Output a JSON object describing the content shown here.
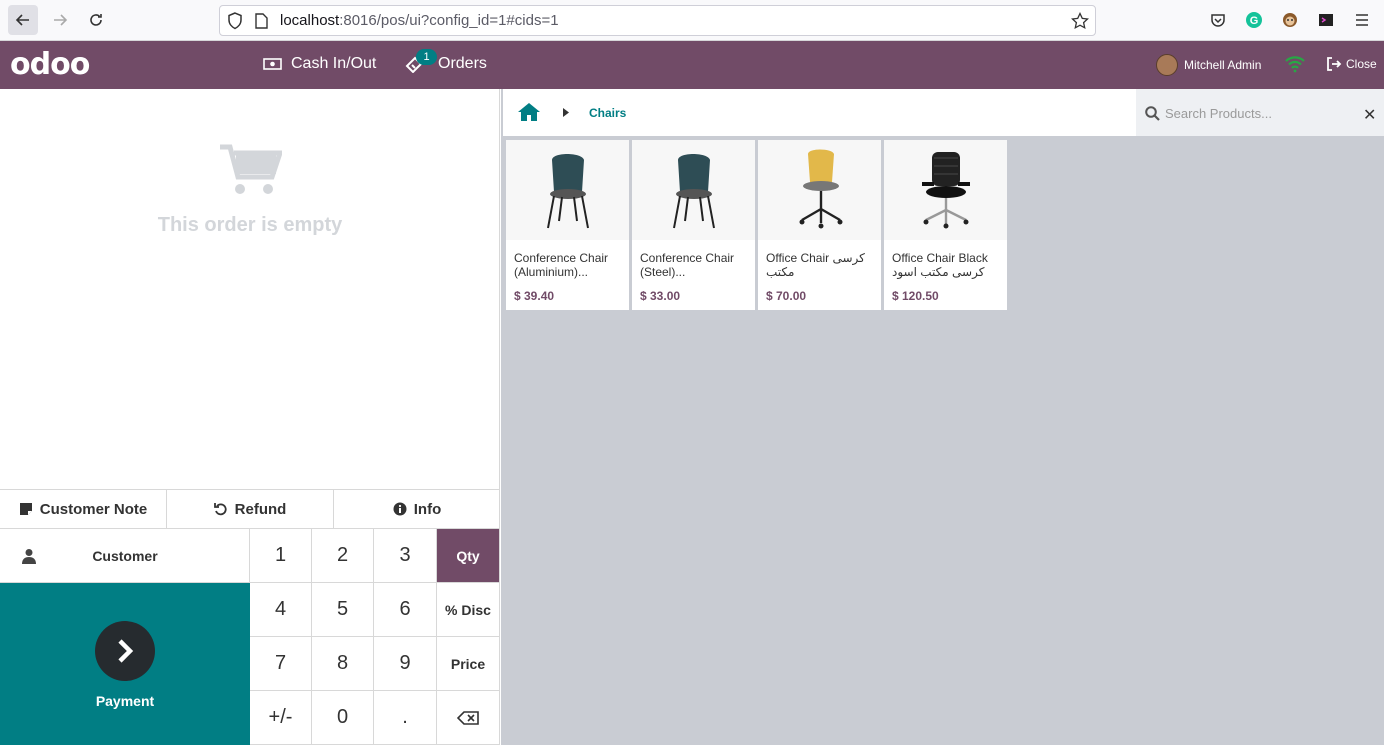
{
  "browser": {
    "url_host": "localhost",
    "url_rest": ":8016/pos/ui?config_id=1#cids=1"
  },
  "header": {
    "logo": "odoo",
    "cash_label": "Cash In/Out",
    "orders_label": "Orders",
    "orders_count": "1",
    "user_name": "Mitchell Admin",
    "close_label": "Close"
  },
  "order": {
    "empty_text": "This order is empty"
  },
  "controls": {
    "customer_note": "Customer Note",
    "refund": "Refund",
    "info": "Info",
    "customer": "Customer",
    "payment": "Payment"
  },
  "numpad": {
    "keys": [
      "1",
      "2",
      "3",
      "Qty",
      "4",
      "5",
      "6",
      "% Disc",
      "7",
      "8",
      "9",
      "Price",
      "+/-",
      "0",
      ".",
      ""
    ],
    "active_mode": "Qty"
  },
  "breadcrumb": {
    "current": "Chairs"
  },
  "search": {
    "placeholder": "Search Products..."
  },
  "products": [
    {
      "name": "Conference Chair (Aluminium)...",
      "price": "$ 39.40",
      "color": "#2e4d55"
    },
    {
      "name": "Conference Chair (Steel)...",
      "price": "$ 33.00",
      "color": "#2e4d55"
    },
    {
      "name": "Office Chair كرسی مکتب",
      "price": "$ 70.00",
      "color": "#e2b84a"
    },
    {
      "name": "Office Chair Black كرسی مکتب اسود",
      "price": "$ 120.50",
      "color": "#222222"
    }
  ],
  "colors": {
    "brand": "#714b67",
    "accent": "#017e84"
  }
}
